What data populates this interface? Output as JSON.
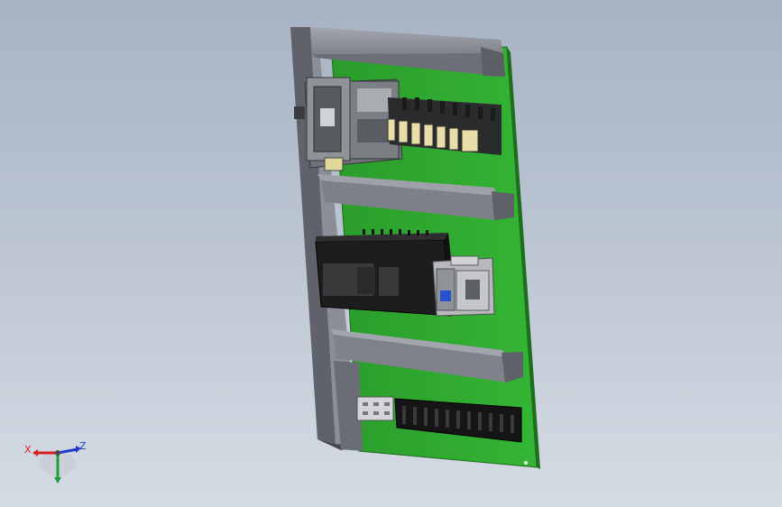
{
  "scene": {
    "background_colors": [
      "#a7b3c4",
      "#d5dbe4"
    ],
    "model": {
      "board_color": "#2fa82f",
      "frame_color": "#8d9099",
      "breaker_color": "#6f7378",
      "relay_color": "#e8dca8",
      "plc_color": "#1f1f1f",
      "contactor_color": "#b7b9bc"
    }
  },
  "triad": {
    "x_label": "X",
    "z_label": "Z",
    "x_color": "#d81e1e",
    "y_color": "#1e9e3a",
    "z_color": "#1e3cc8"
  }
}
